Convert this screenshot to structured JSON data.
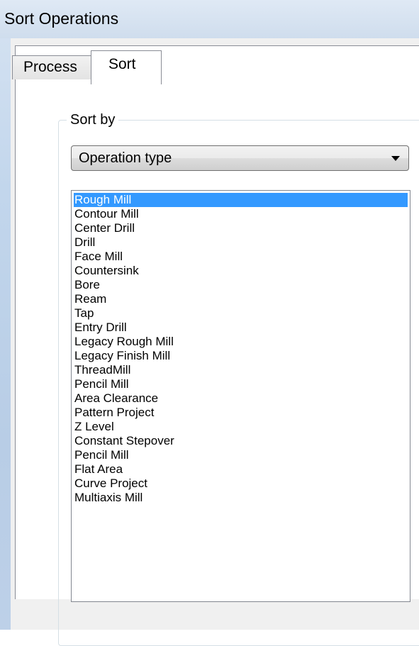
{
  "window": {
    "title": "Sort Operations"
  },
  "tabs": [
    {
      "label": "Process",
      "active": false
    },
    {
      "label": "Sort",
      "active": true
    }
  ],
  "sort_group": {
    "label": "Sort by",
    "dropdown": {
      "selected": "Operation type",
      "icon": "chevron-down-icon"
    },
    "list": {
      "selected_index": 0,
      "selection_color": "#3399ff",
      "items": [
        "Rough Mill",
        "Contour Mill",
        "Center Drill",
        "Drill",
        "Face Mill",
        "Countersink",
        "Bore",
        "Ream",
        "Tap",
        "Entry Drill",
        "Legacy Rough Mill",
        "Legacy Finish Mill",
        "ThreadMill",
        "Pencil Mill",
        "Area Clearance",
        "Pattern Project",
        "Z Level",
        "Constant Stepover",
        "Pencil Mill",
        "Flat Area",
        "Curve Project",
        "Multiaxis Mill"
      ]
    }
  }
}
